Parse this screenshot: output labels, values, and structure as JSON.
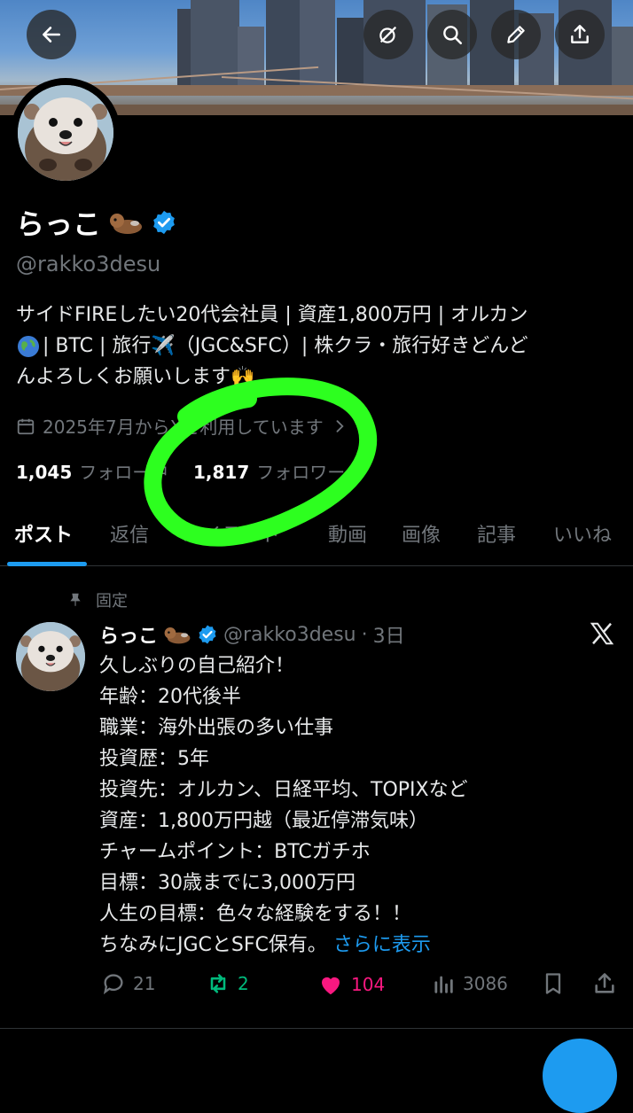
{
  "profile": {
    "name": "らっこ",
    "handle": "@rakko3desu",
    "bio_lines": [
      "サイドFIREしたい20代会社員 | 資産1,800万円 | オルカン",
      " | BTC | 旅行✈️（JGC&SFC）| 株クラ・旅行好きどんど",
      "んよろしくお願いします🙌"
    ],
    "joined": "2025年7月からXを利用しています",
    "following_count": "1,045",
    "following_label": "フォロー中",
    "followers_count": "1,817",
    "followers_label": "フォロワー"
  },
  "tabs": [
    "ポスト",
    "返信",
    "ハイライト",
    "動画",
    "画像",
    "記事",
    "いいね"
  ],
  "post": {
    "pinned_label": "固定",
    "name": "らっこ",
    "handle": "@rakko3desu",
    "time": "3日",
    "lines": [
      "久しぶりの自己紹介！",
      "年齢：20代後半",
      "職業：海外出張の多い仕事",
      "投資歴：5年",
      "投資先：オルカン、日経平均、TOPIXなど",
      "資産：1,800万円越（最近停滞気味）",
      "チャームポイント：BTCガチホ",
      "目標：30歳までに3,000万円",
      "人生の目標：色々な経験をする！！"
    ],
    "last_line": "ちなみにJGCとSFC保有。",
    "more_label": "さらに表示",
    "replies": "21",
    "reposts": "2",
    "likes": "104",
    "views": "3086"
  },
  "colors": {
    "accent": "#1d9bf0",
    "like": "#f91880",
    "repost": "#00ba7c",
    "highlight": "#2dff1f"
  }
}
